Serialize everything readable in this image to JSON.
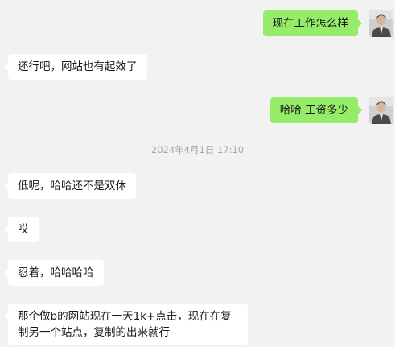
{
  "messages": [
    {
      "side": "out",
      "text": "现在工作怎么样"
    },
    {
      "side": "in",
      "text": "还行吧，网站也有起效了"
    },
    {
      "side": "out",
      "text": "哈哈 工资多少"
    },
    {
      "type": "time",
      "text": "2024年4月1日 17:10"
    },
    {
      "side": "in",
      "text": "低呢，哈哈还不是双休"
    },
    {
      "side": "in",
      "text": "哎"
    },
    {
      "side": "in",
      "text": "忍着，哈哈哈哈"
    },
    {
      "side": "in",
      "text": "那个做b的网站现在一天1k+点击，现在在复制另一个站点，复制的出来就行"
    }
  ],
  "colors": {
    "background": "#f2f2f2",
    "outgoing_bubble": "#95ec69",
    "incoming_bubble": "#ffffff",
    "timestamp_text": "#a6a6a6"
  },
  "avatar": {
    "icon": "user-avatar-photo"
  }
}
